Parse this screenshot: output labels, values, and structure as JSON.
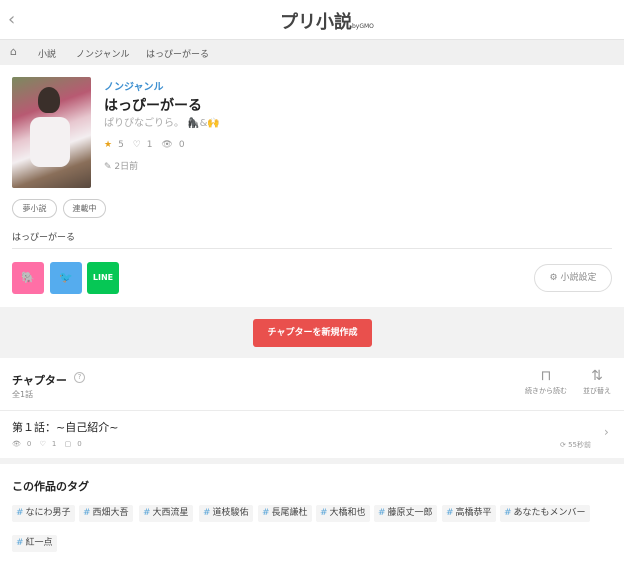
{
  "header": {
    "back_icon": "chevron-left-icon",
    "logo": "プリ小説",
    "logo_by": "byGMO"
  },
  "breadcrumb": {
    "home_icon": "home-icon",
    "items": [
      "小説",
      "ノンジャンル",
      "はっぴーがーる"
    ]
  },
  "novel": {
    "genre": "ノンジャンル",
    "title": "はっぴーがーる",
    "author": "ぱりぴなごりら。 🦍&🙌",
    "stars": "5",
    "hearts": "1",
    "views": "0",
    "updated": "2日前",
    "badges": [
      "夢小説",
      "連載中"
    ],
    "description": "はっぴーがーる"
  },
  "share": {
    "items": [
      "elephant-share-icon",
      "twitter-icon",
      "line-icon"
    ],
    "line_label": "LINE"
  },
  "settings_label": "小説設定",
  "create_chapter_label": "チャプターを新規作成",
  "chapters": {
    "heading": "チャプター",
    "count": "全1話",
    "continue_label": "続きから読む",
    "sort_label": "並び替え",
    "list": [
      {
        "name": "第１話：~自己紹介~",
        "views": "0",
        "hearts": "1",
        "comments": "0",
        "time": "55秒前"
      }
    ]
  },
  "tags": {
    "heading": "この作品のタグ",
    "list": [
      "なにわ男子",
      "西畑大吾",
      "大西流星",
      "道枝駿佑",
      "長尾謙杜",
      "大橋和也",
      "藤原丈一郎",
      "高橋恭平",
      "あなたもメンバー",
      "紅一点"
    ]
  },
  "colors": {
    "accent": "#e9504d",
    "link": "#3d8fd0",
    "star": "#e8a21b",
    "twitter": "#55acee",
    "line": "#06c755",
    "elephant": "#ff6fa6"
  }
}
